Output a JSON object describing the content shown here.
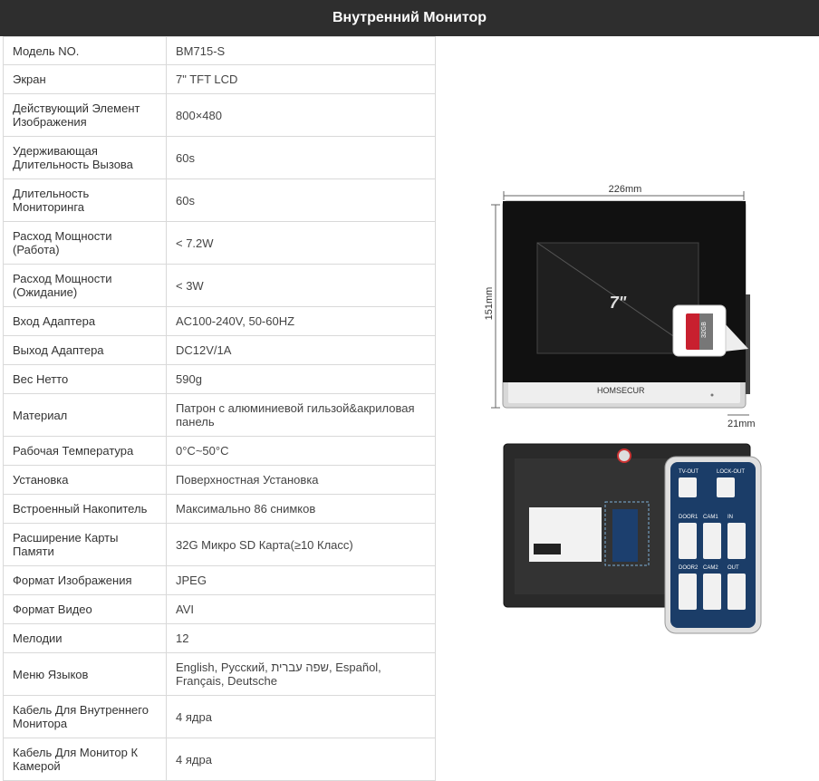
{
  "header": {
    "title": "Внутренний  Монитор"
  },
  "specs": [
    {
      "label": "Модель NO.",
      "value": "BM715-S"
    },
    {
      "label": "Экран",
      "value": "7\" TFT LCD"
    },
    {
      "label": "Действующий Элемент Изображения",
      "value": "800×480"
    },
    {
      "label": "Удерживающая Длительность Вызова",
      "value": "60s"
    },
    {
      "label": "Длительность Мониторинга",
      "value": "60s"
    },
    {
      "label": "Расход Мощности (Работа)",
      "value": "< 7.2W"
    },
    {
      "label": "Расход Мощности (Ожидание)",
      "value": "< 3W"
    },
    {
      "label": "Вход Адаптера",
      "value": "AC100-240V, 50-60HZ"
    },
    {
      "label": "Выход Адаптера",
      "value": "DC12V/1A"
    },
    {
      "label": "Вес Нетто",
      "value": "590g"
    },
    {
      "label": "Материал",
      "value": "Патрон с алюминиевой гильзой&акриловая панель"
    },
    {
      "label": "Рабочая Температура",
      "value": "0°C~50°C"
    },
    {
      "label": "Установка",
      "value": "Поверхностная Установка"
    },
    {
      "label": "Встроенный Накопитель",
      "value": "Максимально 86 снимков"
    },
    {
      "label": "Расширение Карты Памяти",
      "value": "32G Микро SD Карта(≥10 Класс)"
    },
    {
      "label": "Формат Изображения",
      "value": "JPEG"
    },
    {
      "label": "Формат Видео",
      "value": "AVI"
    },
    {
      "label": "Мелодии",
      "value": "12"
    },
    {
      "label": "Меню Языков",
      "value": "English, Русский, שפה עברית, Español, Français, Deutsche"
    },
    {
      "label": "Кабель Для Внутреннего Монитора",
      "value": "4 ядра"
    },
    {
      "label": "Кабель Для Монитор К Камерой",
      "value": "4 ядра"
    }
  ],
  "product_image": {
    "width_label": "226mm",
    "height_label": "151mm",
    "depth_label": "21mm",
    "screen_size_label": "7\"",
    "brand_label": "HOMSECUR",
    "sd_card_label": "32GB"
  },
  "back_panel": {
    "ports": [
      "TV-OUT",
      "LOCK-OUT",
      "DOOR1",
      "CAM1",
      "IN",
      "DOOR2",
      "CAM2",
      "OUT"
    ]
  }
}
